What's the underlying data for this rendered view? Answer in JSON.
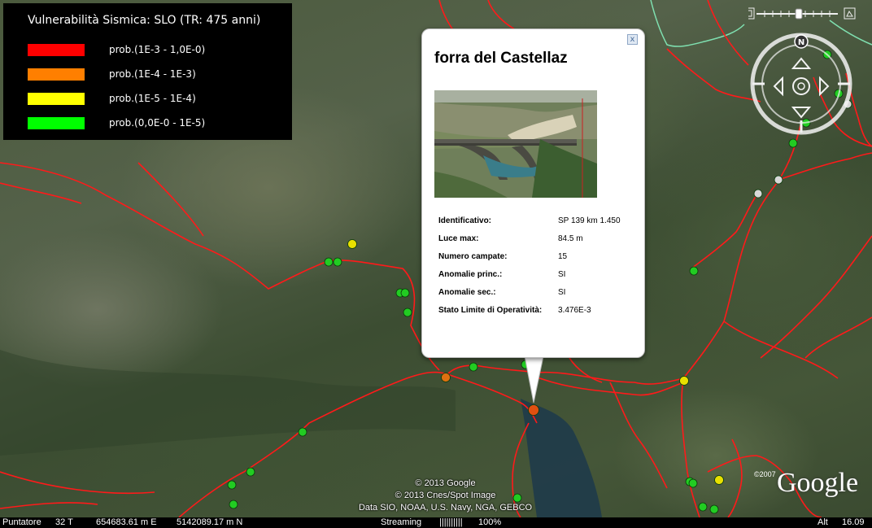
{
  "legend": {
    "title": "Vulnerabilità Sismica: SLO (TR: 475 anni)",
    "items": [
      {
        "label": "prob.(1E-3 - 1,0E-0)",
        "color": "#ff0000"
      },
      {
        "label": "prob.(1E-4 - 1E-3)",
        "color": "#ff7f00"
      },
      {
        "label": "prob.(1E-5 - 1E-4)",
        "color": "#ffff00"
      },
      {
        "label": "prob.(0,0E-0 - 1E-5)",
        "color": "#00ff00"
      }
    ]
  },
  "popup": {
    "title": "forra del Castellaz",
    "close_label": "x",
    "rows": [
      {
        "label": "Identificativo:",
        "value": "SP 139 km 1.450"
      },
      {
        "label": "Luce max:",
        "value": "84.5 m"
      },
      {
        "label": "Numero campate:",
        "value": "15"
      },
      {
        "label": "Anomalie princ.:",
        "value": "SI"
      },
      {
        "label": "Anomalie sec.:",
        "value": "SI"
      },
      {
        "label": "Stato Limite di Operatività:",
        "value": "3.476E-3"
      }
    ]
  },
  "nav": {
    "north_label": "N"
  },
  "credits": {
    "line1": "© 2013 Google",
    "line2": "© 2013 Cnes/Spot Image",
    "line3": "Data SIO, NOAA, U.S. Navy, NGA, GEBCO"
  },
  "logo": {
    "year": "©2007",
    "text": "Google"
  },
  "statusbar": {
    "pointer_label": "Puntatore",
    "zone": "32 T",
    "easting": "654683.61 m E",
    "northing": "5142089.17 m N",
    "streaming_label": "Streaming",
    "streaming_bar": "||||||||||",
    "streaming_pct": "100%",
    "alt_label": "Alt",
    "alt_value": "16.09"
  },
  "colors": {
    "road": "#ff1a1a",
    "marker_green": "#22cc22",
    "marker_yellow": "#e8e000",
    "marker_orange": "#e07010",
    "marker_red": "#e05010",
    "marker_white": "#d8d8d8"
  }
}
